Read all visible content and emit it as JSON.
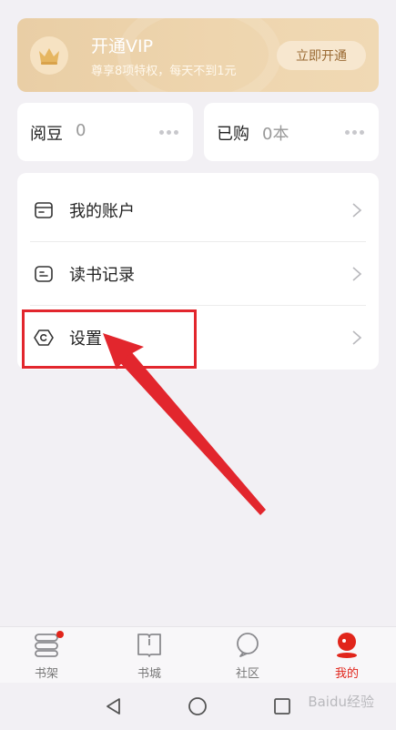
{
  "vip": {
    "title": "开通VIP",
    "subtitle": "尊享8项特权，每天不到1元",
    "button_label": "立即开通"
  },
  "stats": {
    "beans_label": "阅豆",
    "beans_value": "0",
    "purchased_label": "已购",
    "purchased_value": "0本"
  },
  "menu": {
    "items": [
      {
        "label": "我的账户",
        "icon": "wallet-icon"
      },
      {
        "label": "读书记录",
        "icon": "list-icon"
      },
      {
        "label": "设置",
        "icon": "settings-icon"
      }
    ]
  },
  "tabs": [
    {
      "label": "书架",
      "icon": "bookshelf-icon",
      "active": false
    },
    {
      "label": "书城",
      "icon": "bookstore-icon",
      "active": false
    },
    {
      "label": "社区",
      "icon": "community-icon",
      "active": false
    },
    {
      "label": "我的",
      "icon": "profile-icon",
      "active": true
    }
  ],
  "watermark": "Baidu经验",
  "colors": {
    "accent": "#e1251b",
    "vip_gold": "#e9cea5",
    "highlight": "#e2262d"
  }
}
